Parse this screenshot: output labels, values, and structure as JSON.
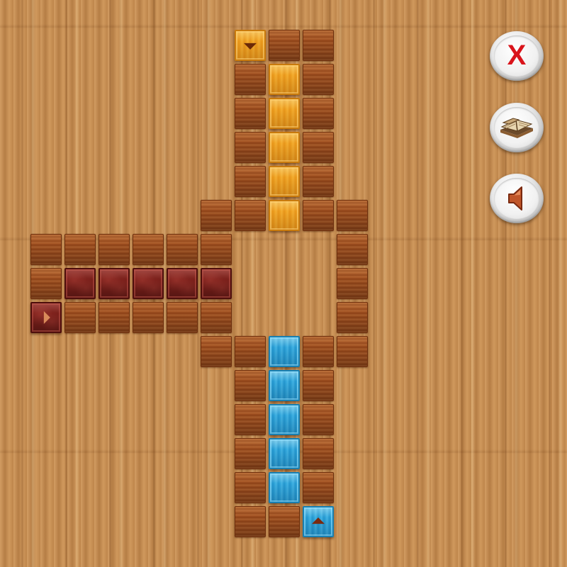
{
  "game": {
    "board": {
      "tiles": [
        {
          "col": 0,
          "row": 0,
          "kind": "orange",
          "arrow": "down"
        },
        {
          "col": 1,
          "row": 0,
          "kind": "empty"
        },
        {
          "col": 2,
          "row": 0,
          "kind": "empty"
        },
        {
          "col": 0,
          "row": 1,
          "kind": "empty"
        },
        {
          "col": 1,
          "row": 1,
          "kind": "orange"
        },
        {
          "col": 2,
          "row": 1,
          "kind": "empty"
        },
        {
          "col": 0,
          "row": 2,
          "kind": "empty"
        },
        {
          "col": 1,
          "row": 2,
          "kind": "orange"
        },
        {
          "col": 2,
          "row": 2,
          "kind": "empty"
        },
        {
          "col": 0,
          "row": 3,
          "kind": "empty"
        },
        {
          "col": 1,
          "row": 3,
          "kind": "orange"
        },
        {
          "col": 2,
          "row": 3,
          "kind": "empty"
        },
        {
          "col": 0,
          "row": 4,
          "kind": "empty"
        },
        {
          "col": 1,
          "row": 4,
          "kind": "orange"
        },
        {
          "col": 2,
          "row": 4,
          "kind": "empty"
        },
        {
          "col": -1,
          "row": 5,
          "kind": "empty"
        },
        {
          "col": 0,
          "row": 5,
          "kind": "empty"
        },
        {
          "col": 1,
          "row": 5,
          "kind": "orange"
        },
        {
          "col": 2,
          "row": 5,
          "kind": "empty"
        },
        {
          "col": 3,
          "row": 5,
          "kind": "empty"
        },
        {
          "col": -6,
          "row": 6,
          "kind": "empty"
        },
        {
          "col": -5,
          "row": 6,
          "kind": "empty"
        },
        {
          "col": -4,
          "row": 6,
          "kind": "empty"
        },
        {
          "col": -3,
          "row": 6,
          "kind": "empty"
        },
        {
          "col": -2,
          "row": 6,
          "kind": "empty"
        },
        {
          "col": -1,
          "row": 6,
          "kind": "empty"
        },
        {
          "col": 3,
          "row": 6,
          "kind": "empty"
        },
        {
          "col": -6,
          "row": 7,
          "kind": "empty"
        },
        {
          "col": -5,
          "row": 7,
          "kind": "maroon"
        },
        {
          "col": -4,
          "row": 7,
          "kind": "maroon"
        },
        {
          "col": -3,
          "row": 7,
          "kind": "maroon"
        },
        {
          "col": -2,
          "row": 7,
          "kind": "maroon"
        },
        {
          "col": -1,
          "row": 7,
          "kind": "maroon"
        },
        {
          "col": 3,
          "row": 7,
          "kind": "empty"
        },
        {
          "col": -6,
          "row": 8,
          "kind": "maroon",
          "arrow": "right"
        },
        {
          "col": -5,
          "row": 8,
          "kind": "empty"
        },
        {
          "col": -4,
          "row": 8,
          "kind": "empty"
        },
        {
          "col": -3,
          "row": 8,
          "kind": "empty"
        },
        {
          "col": -2,
          "row": 8,
          "kind": "empty"
        },
        {
          "col": -1,
          "row": 8,
          "kind": "empty"
        },
        {
          "col": 3,
          "row": 8,
          "kind": "empty"
        },
        {
          "col": -1,
          "row": 9,
          "kind": "empty"
        },
        {
          "col": 0,
          "row": 9,
          "kind": "empty"
        },
        {
          "col": 1,
          "row": 9,
          "kind": "blue"
        },
        {
          "col": 2,
          "row": 9,
          "kind": "empty"
        },
        {
          "col": 3,
          "row": 9,
          "kind": "empty"
        },
        {
          "col": 0,
          "row": 10,
          "kind": "empty"
        },
        {
          "col": 1,
          "row": 10,
          "kind": "blue"
        },
        {
          "col": 2,
          "row": 10,
          "kind": "empty"
        },
        {
          "col": 0,
          "row": 11,
          "kind": "empty"
        },
        {
          "col": 1,
          "row": 11,
          "kind": "blue"
        },
        {
          "col": 2,
          "row": 11,
          "kind": "empty"
        },
        {
          "col": 0,
          "row": 12,
          "kind": "empty"
        },
        {
          "col": 1,
          "row": 12,
          "kind": "blue"
        },
        {
          "col": 2,
          "row": 12,
          "kind": "empty"
        },
        {
          "col": 0,
          "row": 13,
          "kind": "empty"
        },
        {
          "col": 1,
          "row": 13,
          "kind": "blue"
        },
        {
          "col": 2,
          "row": 13,
          "kind": "empty"
        },
        {
          "col": 0,
          "row": 14,
          "kind": "empty"
        },
        {
          "col": 1,
          "row": 14,
          "kind": "empty"
        },
        {
          "col": 2,
          "row": 14,
          "kind": "blue",
          "arrow": "up"
        }
      ]
    },
    "colors": {
      "orange_block": "#f2a21e",
      "blue_block": "#2aa6dd",
      "maroon_block": "#7a1f1a",
      "empty_cell": "#a04d1c",
      "close_x": "#d9141b"
    }
  },
  "controls": {
    "close": {
      "label": "X",
      "icon": "close-icon"
    },
    "book": {
      "icon": "book-icon"
    },
    "sound": {
      "icon": "speaker-icon"
    }
  }
}
